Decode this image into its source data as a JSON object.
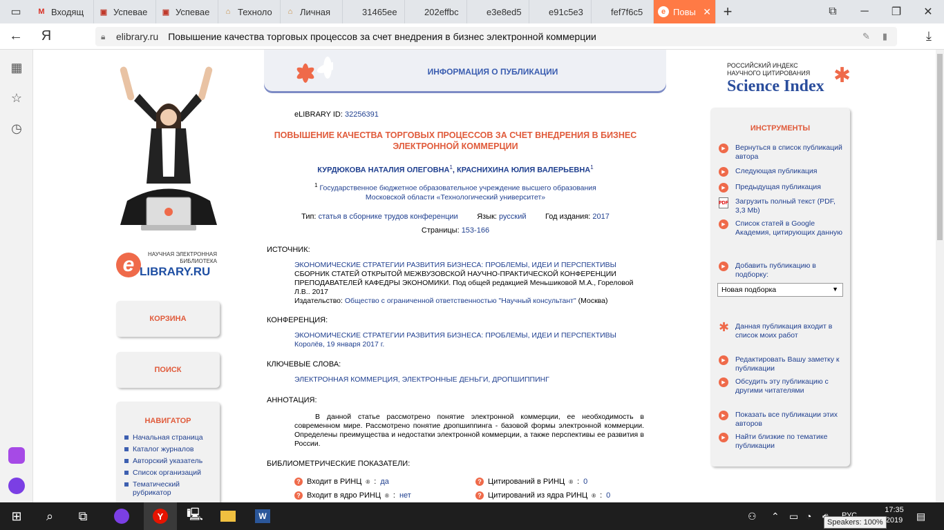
{
  "browser": {
    "tabs": [
      {
        "label": "Входящ",
        "icon": "gmail-icon",
        "color": "#d93025",
        "glyph": "M"
      },
      {
        "label": "Успевае",
        "icon": "shield-icon",
        "color": "#c0392b",
        "glyph": "▣"
      },
      {
        "label": "Успевае",
        "icon": "shield-icon",
        "color": "#c0392b",
        "glyph": "▣"
      },
      {
        "label": "Техноло",
        "icon": "university-icon",
        "color": "#c88a3a",
        "glyph": "⌂"
      },
      {
        "label": "Личная",
        "icon": "university-icon",
        "color": "#c88a3a",
        "glyph": "⌂"
      },
      {
        "label": "31465ee",
        "icon": "blank-icon",
        "color": "#e3e6ea",
        "glyph": ""
      },
      {
        "label": "202effbc",
        "icon": "blank-icon",
        "color": "#e3e6ea",
        "glyph": ""
      },
      {
        "label": "e3e8ed5",
        "icon": "blank-icon",
        "color": "#e3e6ea",
        "glyph": ""
      },
      {
        "label": "e91c5e3",
        "icon": "blank-icon",
        "color": "#e3e6ea",
        "glyph": ""
      },
      {
        "label": "fef7f6c5",
        "icon": "blank-icon",
        "color": "#e3e6ea",
        "glyph": ""
      }
    ],
    "active_tab": {
      "label": "Повы",
      "icon": "elibrary-icon"
    },
    "url_domain": "elibrary.ru",
    "url_title": "Повышение качества торговых процессов за счет внедрения в бизнес электронной коммерции",
    "accent": "#ff7a45"
  },
  "left": {
    "elib_small": "НАУЧНАЯ ЭЛЕКТРОННАЯ БИБЛИОТЕКА",
    "elib_logo": "LIBRARY.RU",
    "elib_e": "e",
    "cart": "КОРЗИНА",
    "search": "ПОИСК",
    "navigator": {
      "title": "НАВИГАТОР",
      "items": [
        "Начальная страница",
        "Каталог журналов",
        "Авторский указатель",
        "Список организаций",
        "Тематический рубрикатор"
      ]
    }
  },
  "header": {
    "title": "ИНФОРМАЦИЯ О ПУБЛИКАЦИИ"
  },
  "publication": {
    "id_label": "eLIBRARY ID:",
    "id": "32256391",
    "title": "ПОВЫШЕНИЕ КАЧЕСТВА ТОРГОВЫХ ПРОЦЕССОВ ЗА СЧЕТ ВНЕДРЕНИЯ В БИЗНЕС ЭЛЕКТРОННОЙ КОММЕРЦИИ",
    "author1": "КУРДЮКОВА НАТАЛИЯ ОЛЕГОВНА",
    "author2": "КРАСНИХИНА ЮЛИЯ ВАЛЕРЬЕВНА",
    "sup": "1",
    "comma": ", ",
    "affiliation": "Государственное бюджетное образовательное учреждение высшего образования Московской области «Технологический университет»",
    "type_label": "Тип:",
    "type": "статья в сборнике трудов конференции",
    "lang_label": "Язык:",
    "lang": "русский",
    "year_label": "Год издания:",
    "year": "2017",
    "pages_label": "Страницы:",
    "pages": "153-166",
    "source_label": "ИСТОЧНИК:",
    "source_title": "ЭКОНОМИЧЕСКИЕ СТРАТЕГИИ РАЗВИТИЯ БИЗНЕСА: ПРОБЛЕМЫ, ИДЕИ И ПЕРСПЕКТИВЫ",
    "source_desc": "СБОРНИК СТАТЕЙ ОТКРЫТОЙ МЕЖВУЗОВСКОЙ НАУЧНО-ПРАКТИЧЕСКОЙ КОНФЕРЕНЦИИ ПРЕПОДАВАТЕЛЕЙ КАФЕДРЫ ЭКОНОМИКИ. Под общей редакцией Меньшиковой М.А., Гореловой Л.В.. 2017",
    "publisher_label": "Издательство:",
    "publisher": "Общество с ограниченной ответственностью \"Научный консультант\"",
    "publisher_city": "(Москва)",
    "conf_label": "КОНФЕРЕНЦИЯ:",
    "conf_title": "ЭКОНОМИЧЕСКИЕ СТРАТЕГИИ РАЗВИТИЯ БИЗНЕСА: ПРОБЛЕМЫ, ИДЕИ И ПЕРСПЕКТИВЫ",
    "conf_place": "Королёв, 19 января 2017 г.",
    "keywords_label": "КЛЮЧЕВЫЕ СЛОВА:",
    "keywords": "ЭЛЕКТРОННАЯ КОММЕРЦИЯ, ЭЛЕКТРОННЫЕ ДЕНЬГИ, ДРОПШИППИНГ",
    "abstract_label": "АННОТАЦИЯ:",
    "abstract": "В данной статье рассмотрено понятие электронной коммерции, ее необходимость в современном мире. Рассмотрено понятие дропшиппинга - базовой формы электронной коммерции. Определены преимущества и недостатки электронной коммерции, а также перспективы ее развития в России.",
    "bib_label": "БИБЛИОМЕТРИЧЕСКИЕ ПОКАЗАТЕЛИ:",
    "bib": [
      {
        "label": "Входит в РИНЦ",
        "value": "да"
      },
      {
        "label": "Цитирований в РИНЦ",
        "value": "0"
      },
      {
        "label": "Входит в ядро РИНЦ",
        "value": "нет"
      },
      {
        "label": "Цитирований из ядра РИНЦ",
        "value": "0"
      }
    ],
    "reg": "®",
    "colon": ": "
  },
  "right": {
    "si_small1": "РОССИЙСКИЙ ИНДЕКС",
    "si_small2": "НАУЧНОГО ЦИТИРОВАНИЯ",
    "si_big": "Science Index",
    "tools_title": "ИНСТРУМЕНТЫ",
    "tools": [
      "Вернуться в список публикаций автора",
      "Следующая публикация",
      "Предыдущая публикация",
      "Загрузить полный текст (PDF, 3,3 Mb)",
      "Список статей в Google Академия, цитирующих данную",
      "Добавить публикацию в подборку:",
      "Данная публикация входит в список моих работ",
      "Редактировать Вашу заметку к публикации",
      "Обсудить эту публикацию с другими читателями",
      "Показать все публикации этих авторов",
      "Найти близкие по тематике публикации"
    ],
    "select_value": "Новая подборка",
    "pdf_glyph": "PDF"
  },
  "taskbar": {
    "lang": "РУС",
    "time": "17:35",
    "date": "2019",
    "tooltip": "Speakers: 100%"
  }
}
